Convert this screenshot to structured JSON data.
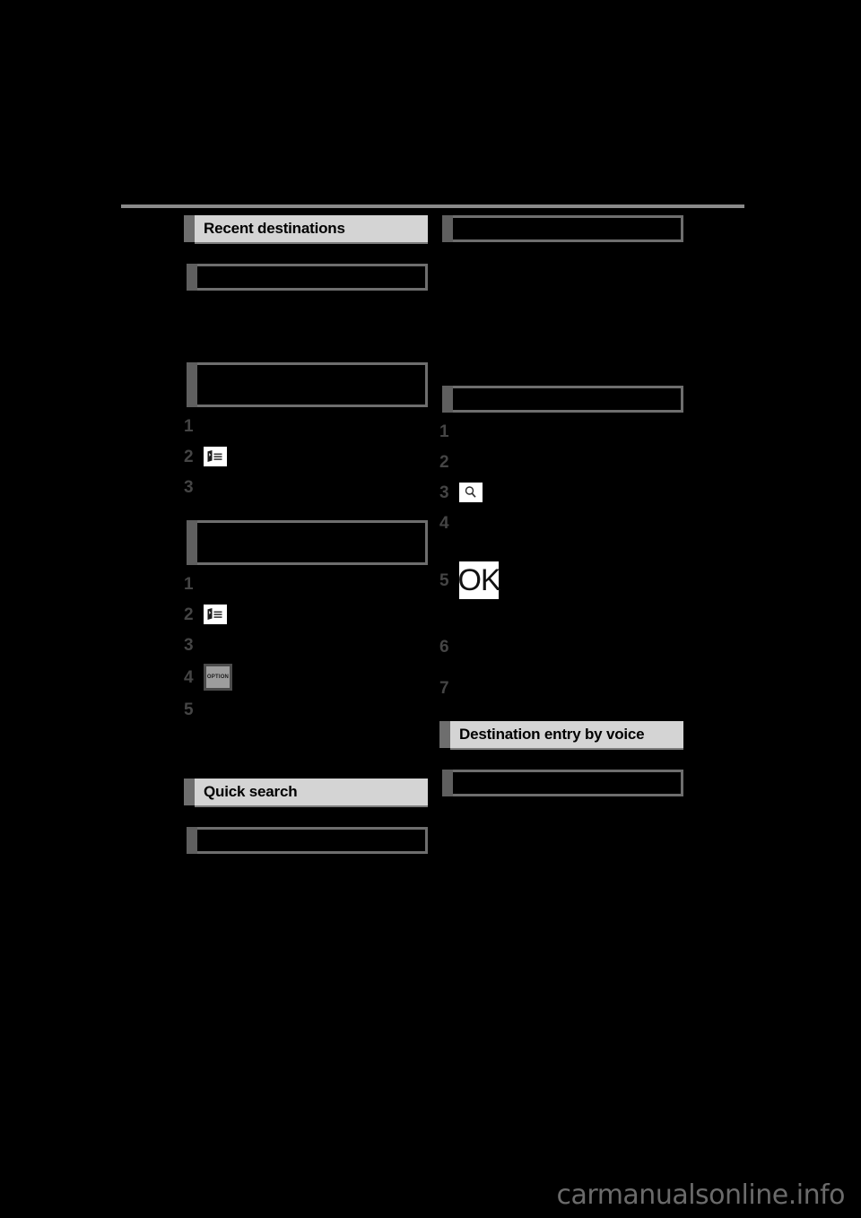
{
  "page": {
    "background_color": "#000000",
    "rule_color": "#8a8a8a",
    "header_band_color": "#d4d4d4",
    "header_tab_color": "#6e6e6e",
    "step_number_color": "#454545",
    "watermark": "carmanualsonline.info"
  },
  "left_column": {
    "section_header": {
      "label": "Recent destinations"
    },
    "subheaders": [
      {
        "label": "",
        "redacted": true
      },
      {
        "label": "",
        "redacted": true
      },
      {
        "label": "",
        "redacted": true
      }
    ],
    "procedure_1": {
      "steps": [
        {
          "number": "1",
          "text": "",
          "icon": ""
        },
        {
          "number": "2",
          "text": "",
          "icon": "map-menu-icon"
        },
        {
          "number": "3",
          "text": "",
          "icon": ""
        }
      ]
    },
    "procedure_2": {
      "steps": [
        {
          "number": "1",
          "text": "",
          "icon": ""
        },
        {
          "number": "2",
          "text": "",
          "icon": "map-menu-icon"
        },
        {
          "number": "3",
          "text": "",
          "icon": ""
        },
        {
          "number": "4",
          "text": "",
          "icon": "option-button-icon",
          "icon_label": "OPTION"
        },
        {
          "number": "5",
          "text": "",
          "icon": ""
        }
      ]
    },
    "section_header_2": {
      "label": "Quick search"
    }
  },
  "right_column": {
    "subheaders": [
      {
        "label": "",
        "redacted": true
      },
      {
        "label": "",
        "redacted": true
      },
      {
        "label": "",
        "redacted": true
      }
    ],
    "procedure_1": {
      "steps": [
        {
          "number": "1",
          "text": "",
          "icon": ""
        },
        {
          "number": "2",
          "text": "",
          "icon": ""
        },
        {
          "number": "3",
          "text": "",
          "icon": "search-icon"
        },
        {
          "number": "4",
          "text": "",
          "icon": ""
        },
        {
          "number": "5",
          "text": "",
          "icon": "ok-button-icon",
          "icon_label": "OK"
        },
        {
          "number": "6",
          "text": "",
          "icon": ""
        },
        {
          "number": "7",
          "text": "",
          "icon": ""
        }
      ]
    },
    "section_header": {
      "label": "Destination entry by voice"
    }
  }
}
